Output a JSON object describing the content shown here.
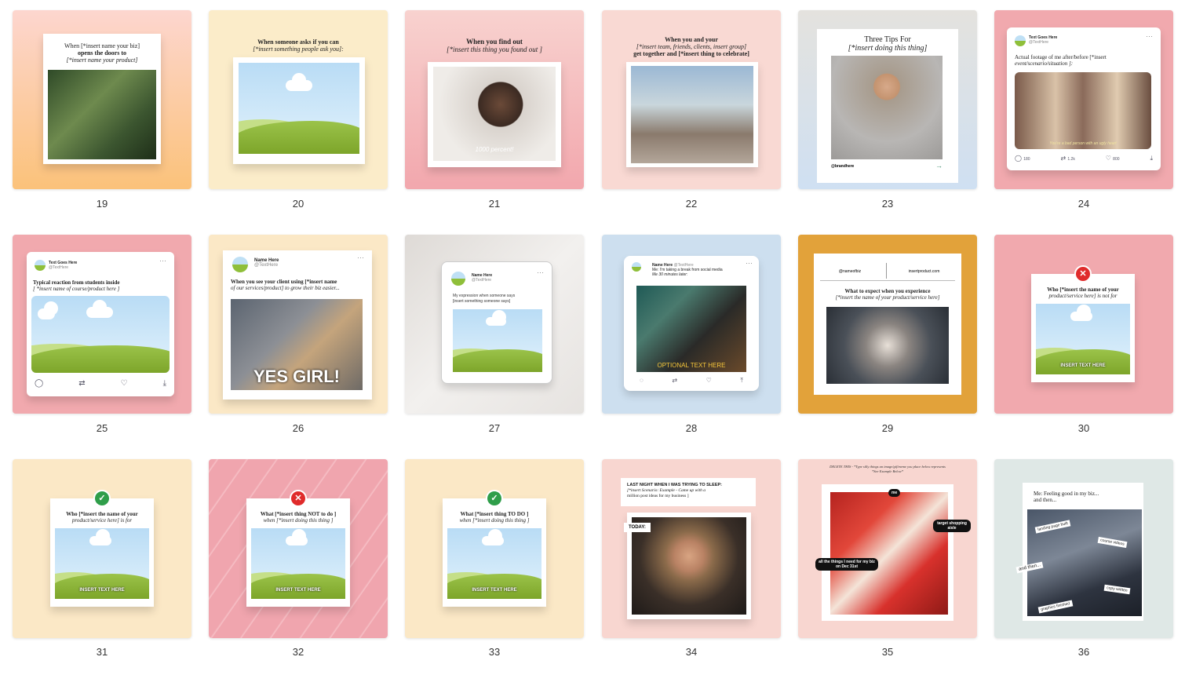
{
  "cards": [
    {
      "n": "19",
      "caption1": "When [*insert name your biz]",
      "caption2": "opens the doors to",
      "caption3": "[*insert name your product]"
    },
    {
      "n": "20",
      "caption1": "When someone asks if you can",
      "caption2": "[*insert something people ask you]:"
    },
    {
      "n": "21",
      "caption1": "When you find out",
      "caption2": "[*insert this thing you found out ]",
      "overlay": "1000 percent!"
    },
    {
      "n": "22",
      "caption1": "When you and your",
      "caption2": "[*insert team, friends, clients, insert group]",
      "caption3": "get together and [*insert thing to celebrate]"
    },
    {
      "n": "23",
      "caption1": "Three Tips For",
      "caption2": "[*insert doing this thing]",
      "footer": "@brandhere"
    },
    {
      "n": "24",
      "name": "Text Goes Here",
      "handle": "@TextHere",
      "caption1": "Actual footage of me after/before [*insert",
      "caption2": "event/scenario/situation ]:",
      "overlay": "You're a bad person with an ugly heart",
      "stat1": "180",
      "stat2": "1.2k",
      "stat3": "800"
    },
    {
      "n": "25",
      "name": "Text Goes Here",
      "handle": "@TextHere",
      "caption1": "Typical reaction from students inside",
      "caption2": "[ *insert name of course/product here ]"
    },
    {
      "n": "26",
      "name": "Name Here",
      "handle": "@TextHere",
      "caption1": "When you see your client using [*insert name",
      "caption2": "of our services/product] to grow their biz easier...",
      "overlay": "YES GIRL!"
    },
    {
      "n": "27",
      "name": "Name Here",
      "handle": "@TextHere",
      "caption1": "My expression when someone says",
      "caption2": "[insert something someone says]"
    },
    {
      "n": "28",
      "name": "Name Here",
      "handle": "@TextHere",
      "caption1": "Me: I'm taking a break from social media",
      "caption2": "Me 30 minutes later:",
      "overlay": "OPTIONAL TEXT HERE"
    },
    {
      "n": "29",
      "left": "@nameofbiz",
      "right": "insertproduct.com",
      "caption1": "What to expect when you experience",
      "caption2": "[*insert the name of your product/service here]"
    },
    {
      "n": "30",
      "caption1": "Who [*insert the name of your",
      "caption2": "product/service here] is not for",
      "label": "INSERT TEXT HERE"
    },
    {
      "n": "31",
      "caption1": "Who [*insert the name of your",
      "caption2": "product/service here] is for",
      "label": "INSERT TEXT HERE"
    },
    {
      "n": "32",
      "caption1": "What [*insert thing NOT to do ]",
      "caption2": "when [*insert doing this thing ]",
      "label": "INSERT TEXT HERE"
    },
    {
      "n": "33",
      "caption1": "What [*insert thing TO DO ]",
      "caption2": "when [*insert doing this thing ]",
      "label": "INSERT TEXT HERE"
    },
    {
      "n": "34",
      "caption1": "LAST NIGHT WHEN I WAS TRYING TO SLEEP:",
      "caption2": "[*insert Scenario: Example - Came up with a",
      "caption3": "million post ideas for my business ]",
      "tag": "TODAY:"
    },
    {
      "n": "35",
      "caption1": "DELETE THIS - *Type silly things an image/gif/meme you place below represents",
      "caption2": "*See Example Below*",
      "tag_me": "me",
      "tag_target": "target shopping aisle",
      "tag_things": "all the things I need for my biz on Dec 31st"
    },
    {
      "n": "36",
      "caption1": "Me: Feeling good in my biz...",
      "caption2": "and then...",
      "t1": "landing page built",
      "t2": "course videos",
      "t3": "and then...",
      "t4": "copy written",
      "t5": "graphics finished"
    }
  ]
}
